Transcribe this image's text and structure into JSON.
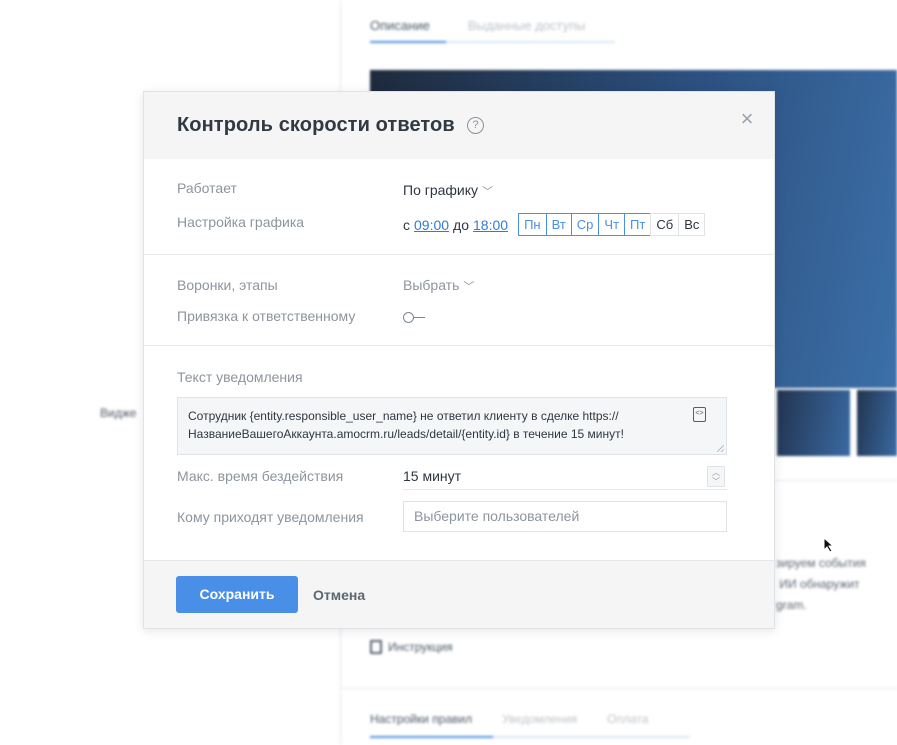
{
  "background": {
    "tabs": [
      {
        "label": "Описание"
      },
      {
        "label": "Выданные доступы"
      }
    ],
    "side_label": "Видже",
    "paragraph": "зируем события\n ИИ обнаружит\ngram.",
    "instruction_label": "Инструкция",
    "bottom_tabs": [
      {
        "label": "Настройки правил"
      },
      {
        "label": "Уведомления"
      },
      {
        "label": "Оплата"
      }
    ]
  },
  "modal": {
    "title": "Контроль скорости ответов",
    "help_glyph": "?",
    "close_glyph": "×",
    "works": {
      "label": "Работает",
      "value": "По графику"
    },
    "schedule": {
      "label": "Настройка графика",
      "from_prefix": "с",
      "from_time": "09:00",
      "to_prefix": "до",
      "to_time": "18:00",
      "days": [
        {
          "label": "Пн",
          "active": true
        },
        {
          "label": "Вт",
          "active": true
        },
        {
          "label": "Ср",
          "active": true
        },
        {
          "label": "Чт",
          "active": true
        },
        {
          "label": "Пт",
          "active": true
        },
        {
          "label": "Сб",
          "active": false
        },
        {
          "label": "Вс",
          "active": false
        }
      ]
    },
    "pipelines": {
      "label": "Воронки, этапы",
      "value": "Выбрать"
    },
    "bind_responsible": {
      "label": "Привязка к ответственному",
      "enabled": false
    },
    "notification": {
      "label": "Текст уведомления",
      "text": "Сотрудник {entity.responsible_user_name} не ответил клиенту в сделке https://НазваниеВашегоАккаунта.amocrm.ru/leads/detail/{entity.id} в течение 15 минут!"
    },
    "max_idle": {
      "label": "Макс. время бездействия",
      "value": "15 минут"
    },
    "recipients": {
      "label": "Кому приходят уведомления",
      "placeholder": "Выберите пользователей"
    },
    "footer": {
      "save_label": "Сохранить",
      "cancel_label": "Отмена"
    }
  },
  "colors": {
    "accent": "#4a8fe7",
    "link": "#2f7bd9",
    "header_bg": "#f5f5f5"
  }
}
